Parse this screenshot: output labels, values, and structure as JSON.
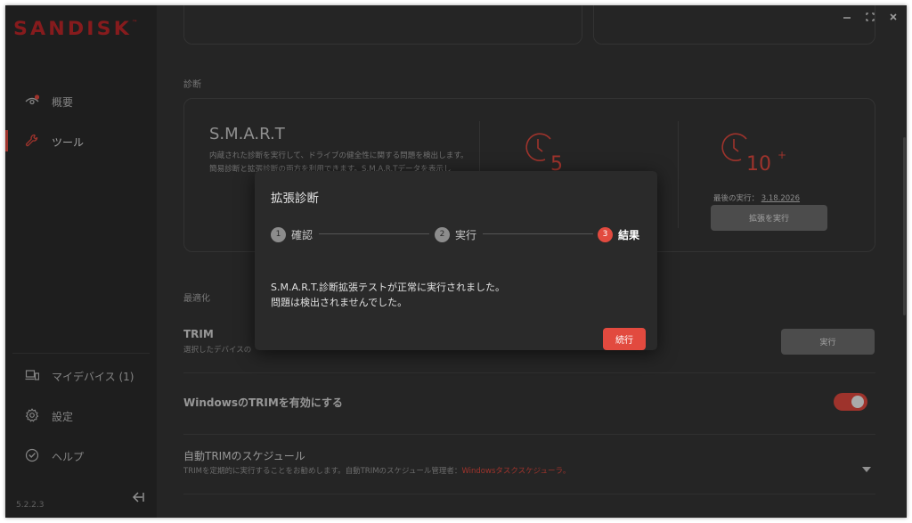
{
  "brand": {
    "logo_text": "SANDISK",
    "tm": "™",
    "accent": "#e24a3f"
  },
  "sidebar": {
    "items": [
      {
        "label": "概要",
        "icon": "eye-alert-icon",
        "active": false
      },
      {
        "label": "ツール",
        "icon": "wrench-icon",
        "active": true
      }
    ],
    "bottom_items": [
      {
        "label": "マイデバイス (1)",
        "icon": "devices-icon"
      },
      {
        "label": "設定",
        "icon": "gear-icon"
      },
      {
        "label": "ヘルプ",
        "icon": "help-icon"
      }
    ],
    "version": "5.2.2.3",
    "collapse_icon": "collapse-left-icon"
  },
  "window_controls": {
    "minimize": "–",
    "maximize": "⛶",
    "close": "✕"
  },
  "diagnostics": {
    "section_label": "診断",
    "smart_title": "S.M.A.R.T",
    "smart_desc": "内蔵された診断を実行して、ドライブの健全性に関する問題を検出します。簡易診断と拡張診断の両方を利用できます。S.M.A.R.Tデータを表示し",
    "quick_clock_value": "5",
    "ext_clock_value": "10",
    "ext_clock_plus": "+",
    "last_run_label": "最後の実行：",
    "last_run_date": "3.18.2026",
    "run_extended_button": "拡張を実行"
  },
  "optimization": {
    "section_label": "最適化",
    "trim_title": "TRIM",
    "trim_desc": "選択したデバイスの",
    "trim_run_button": "実行",
    "windows_trim_label": "WindowsのTRIMを有効にする",
    "windows_trim_enabled": true,
    "schedule_title": "自動TRIMのスケジュール",
    "schedule_desc": "TRIMを定期的に実行することをお勧めします。自動TRIMのスケジュール管理者：",
    "schedule_link": "Windowsタスクスケジューラ",
    "schedule_link_suffix": "。"
  },
  "dialog": {
    "title": "拡張診断",
    "steps": [
      {
        "num": "1",
        "label": "確認"
      },
      {
        "num": "2",
        "label": "実行"
      },
      {
        "num": "3",
        "label": "結果"
      }
    ],
    "current_step": 3,
    "message_line1": "S.M.A.R.T.診断拡張テストが正常に実行されました。",
    "message_line2": "問題は検出されませんでした。",
    "continue_button": "続行"
  }
}
